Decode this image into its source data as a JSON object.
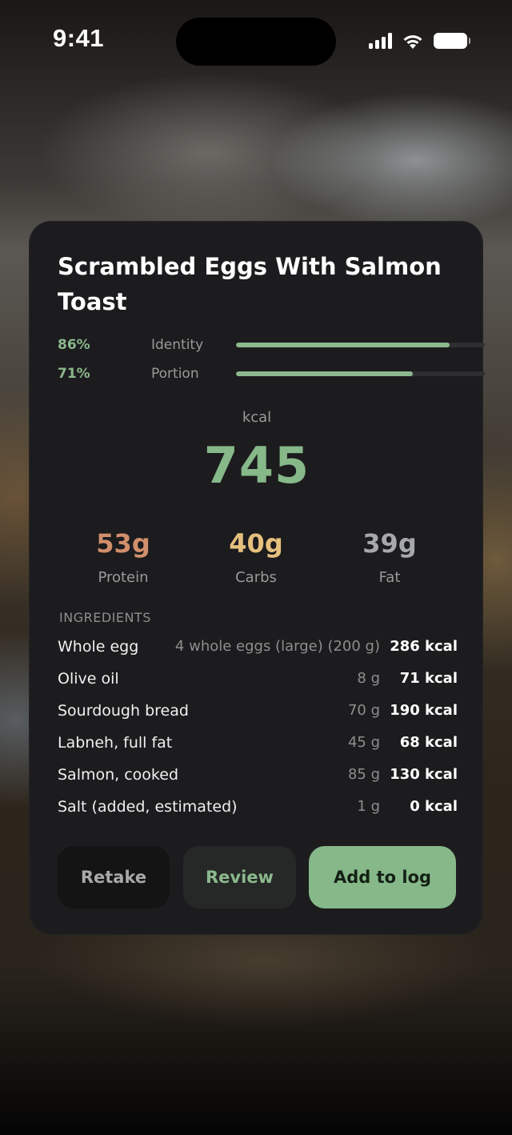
{
  "status_bar": {
    "time": "9:41"
  },
  "meal": {
    "title": "Scrambled Eggs With Salmon Toast"
  },
  "confidence": [
    {
      "percent": "86%",
      "label": "Identity",
      "value": 0.86
    },
    {
      "percent": "71%",
      "label": "Portion",
      "value": 0.71
    }
  ],
  "energy": {
    "unit": "kcal",
    "value": "745"
  },
  "macros": {
    "protein": {
      "value": "53g",
      "label": "Protein",
      "color": "#d18f6c"
    },
    "carbs": {
      "value": "40g",
      "label": "Carbs",
      "color": "#e6c07e"
    },
    "fat": {
      "value": "39g",
      "label": "Fat",
      "color": "#a6a8ab"
    }
  },
  "ingredients": {
    "heading": "INGREDIENTS",
    "items": [
      {
        "name": "Whole egg",
        "portion": "4 whole eggs (large) (200 g)",
        "kcal": "286 kcal"
      },
      {
        "name": "Olive oil",
        "portion": "8 g",
        "kcal": "71 kcal"
      },
      {
        "name": "Sourdough bread",
        "portion": "70 g",
        "kcal": "190 kcal"
      },
      {
        "name": "Labneh, full fat",
        "portion": "45 g",
        "kcal": "68 kcal"
      },
      {
        "name": "Salmon, cooked",
        "portion": "85 g",
        "kcal": "130 kcal"
      },
      {
        "name": "Salt (added, estimated)",
        "portion": "1 g",
        "kcal": "0 kcal"
      }
    ]
  },
  "actions": {
    "retake": "Retake",
    "review": "Review",
    "add": "Add to log"
  },
  "colors": {
    "accent": "#86b889",
    "card": "#1c1c1e"
  }
}
